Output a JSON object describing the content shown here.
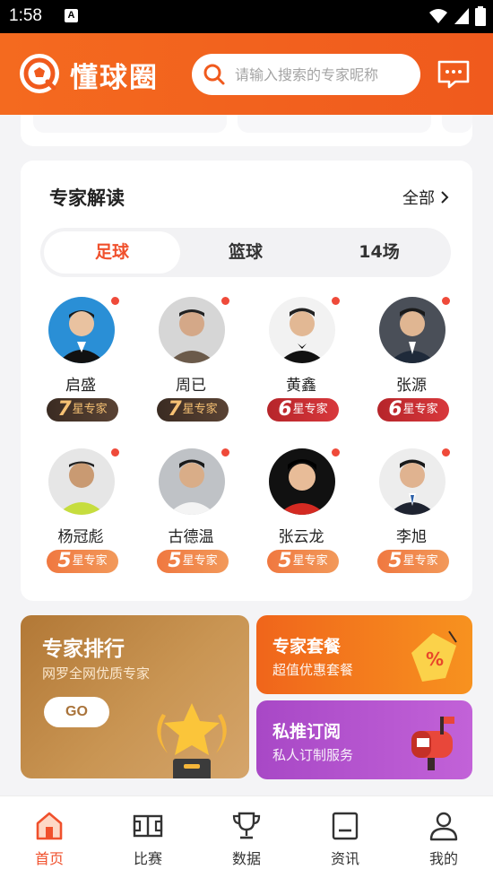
{
  "status_bar": {
    "time": "1:58",
    "indicator": "A"
  },
  "header": {
    "app_name": "懂球圈",
    "search_placeholder": "请输入搜索的专家昵称",
    "icons": [
      "logo-icon",
      "search-icon",
      "message-icon"
    ]
  },
  "experts_section": {
    "title": "专家解读",
    "view_all": "全部",
    "tabs": [
      {
        "label": "足球",
        "active": true
      },
      {
        "label": "篮球",
        "active": false
      },
      {
        "label": "14场",
        "active": false
      }
    ],
    "badge_suffix": "星专家",
    "experts": [
      {
        "name": "启盛",
        "stars": "7",
        "online": true
      },
      {
        "name": "周已",
        "stars": "7",
        "online": true
      },
      {
        "name": "黄鑫",
        "stars": "6",
        "online": true
      },
      {
        "name": "张源",
        "stars": "6",
        "online": true
      },
      {
        "name": "杨冠彪",
        "stars": "5",
        "online": true
      },
      {
        "name": "古德温",
        "stars": "5",
        "online": true
      },
      {
        "name": "张云龙",
        "stars": "5",
        "online": true
      },
      {
        "name": "李旭",
        "stars": "5",
        "online": true
      }
    ]
  },
  "features": {
    "ranking": {
      "title": "专家排行",
      "subtitle": "网罗全网优质专家",
      "button": "GO"
    },
    "package": {
      "title": "专家套餐",
      "subtitle": "超值优惠套餐"
    },
    "subscription": {
      "title": "私推订阅",
      "subtitle": "私人订制服务"
    }
  },
  "bottom_nav": [
    {
      "label": "首页",
      "icon": "home-icon",
      "active": true
    },
    {
      "label": "比赛",
      "icon": "match-field-icon",
      "active": false
    },
    {
      "label": "数据",
      "icon": "trophy-icon",
      "active": false
    },
    {
      "label": "资讯",
      "icon": "news-icon",
      "active": false
    },
    {
      "label": "我的",
      "icon": "profile-icon",
      "active": false
    }
  ],
  "colors": {
    "brand": "#f05a1d",
    "accent_red": "#f0502c"
  }
}
